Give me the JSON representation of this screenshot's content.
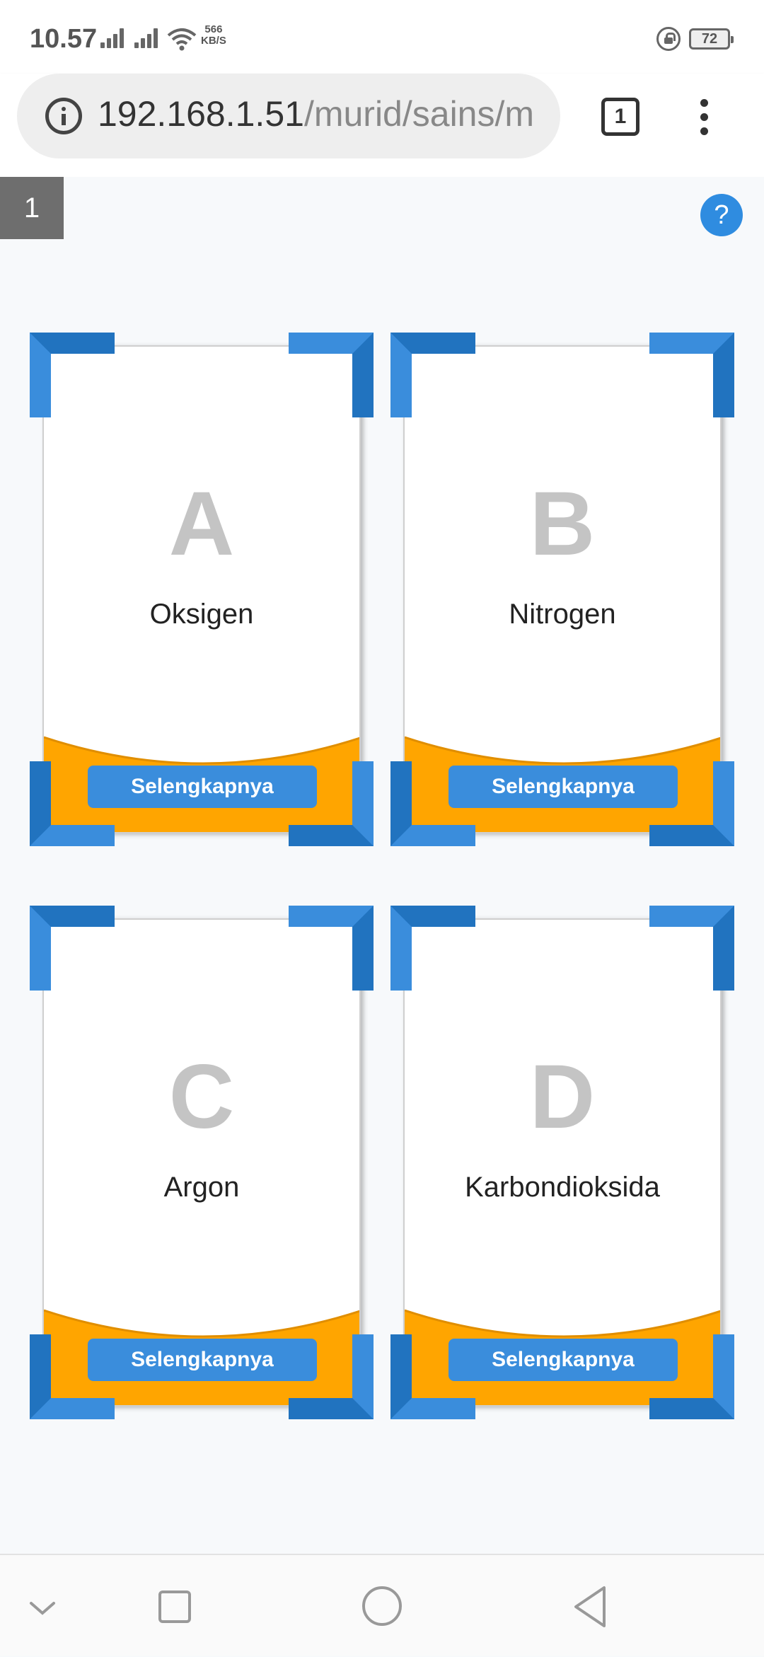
{
  "status_bar": {
    "time": "10.57",
    "network_speed_value": "566",
    "network_speed_unit": "KB/S",
    "battery_level": "72",
    "icons": [
      "signal-icon",
      "signal-icon",
      "wifi-icon",
      "rotation-lock-icon",
      "battery-icon"
    ]
  },
  "browser": {
    "url_host": "192.168.1.51",
    "url_path": "/murid/sains/m",
    "tab_count": "1",
    "icons": [
      "info-icon",
      "tabs-icon",
      "overflow-menu-icon"
    ]
  },
  "quiz": {
    "question_number": "1",
    "help_label": "?",
    "options": [
      {
        "letter": "A",
        "answer": "Oksigen",
        "button": "Selengkapnya"
      },
      {
        "letter": "B",
        "answer": "Nitrogen",
        "button": "Selengkapnya"
      },
      {
        "letter": "C",
        "answer": "Argon",
        "button": "Selengkapnya"
      },
      {
        "letter": "D",
        "answer": "Karbondioksida",
        "button": "Selengkapnya"
      }
    ]
  },
  "colors": {
    "accent_blue": "#2f8ce0",
    "corner_light": "#3a8ddc",
    "corner_dark": "#2173bf",
    "wave_orange": "#ffa500",
    "letter_gray": "#c4c4c4",
    "question_badge": "#6e6e6e"
  },
  "nav_bar": {
    "icons": [
      "collapse-icon",
      "recents-icon",
      "home-icon",
      "back-icon"
    ]
  }
}
